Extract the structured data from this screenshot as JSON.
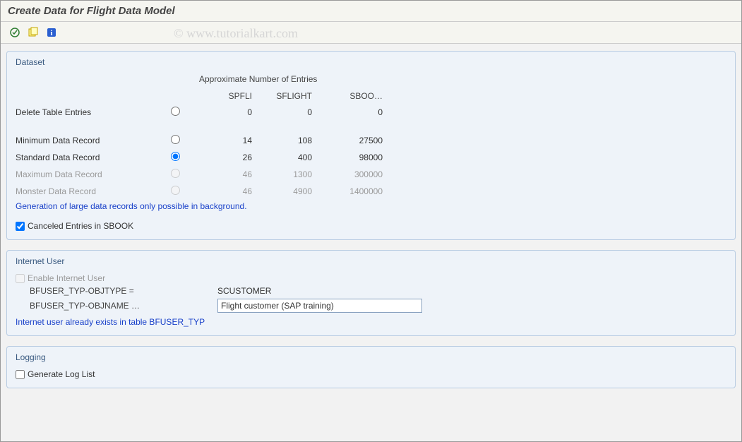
{
  "header": {
    "title": "Create Data for Flight Data Model"
  },
  "watermark": "© www.tutorialkart.com",
  "dataset": {
    "groupTitle": "Dataset",
    "columnsTitle": "Approximate Number of Entries",
    "columns": [
      "SPFLI",
      "SFLIGHT",
      "SBOO…"
    ],
    "rows": [
      {
        "label": "Delete Table Entries",
        "spfli": "0",
        "sflight": "0",
        "sbook": "0",
        "selected": false,
        "enabled": true
      },
      {
        "label": "Minimum Data Record",
        "spfli": "14",
        "sflight": "108",
        "sbook": "27500",
        "selected": false,
        "enabled": true
      },
      {
        "label": "Standard Data Record",
        "spfli": "26",
        "sflight": "400",
        "sbook": "98000",
        "selected": true,
        "enabled": true
      },
      {
        "label": "Maximum Data Record",
        "spfli": "46",
        "sflight": "1300",
        "sbook": "300000",
        "selected": false,
        "enabled": false
      },
      {
        "label": "Monster Data Record",
        "spfli": "46",
        "sflight": "4900",
        "sbook": "1400000",
        "selected": false,
        "enabled": false
      }
    ],
    "note": "Generation of large data records only possible in background.",
    "cancelled": {
      "label": "Canceled Entries in SBOOK",
      "checked": true
    }
  },
  "internetUser": {
    "groupTitle": "Internet User",
    "enable": {
      "label": "Enable Internet User",
      "checked": false,
      "enabled": false
    },
    "objtype": {
      "label": "BFUSER_TYP-OBJTYPE =",
      "value": "SCUSTOMER"
    },
    "objname": {
      "label": "BFUSER_TYP-OBJNAME …",
      "value": "Flight customer (SAP training)"
    },
    "note": "Internet user already exists in table BFUSER_TYP"
  },
  "logging": {
    "groupTitle": "Logging",
    "generate": {
      "label": "Generate Log List",
      "checked": false
    }
  }
}
